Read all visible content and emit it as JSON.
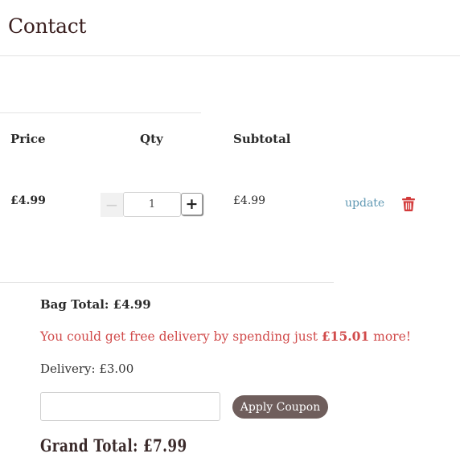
{
  "page": {
    "title": "Contact"
  },
  "cart": {
    "headers": {
      "price": "Price",
      "qty": "Qty",
      "subtotal": "Subtotal"
    },
    "item": {
      "price": "£4.99",
      "quantity": "1",
      "minus_label": "−",
      "plus_label": "+",
      "subtotal": "£4.99",
      "update_label": "update",
      "delete_icon": "trash-icon"
    }
  },
  "summary": {
    "bag_total": "Bag Total: £4.99",
    "free_delivery_prefix": "You could get free delivery by spending just ",
    "free_delivery_amount": "£15.01",
    "free_delivery_suffix": " more!",
    "delivery": "Delivery: £3.00",
    "coupon_placeholder": "",
    "apply_coupon_label": "Apply Coupon",
    "grand_total": "Grand Total: £7.99"
  },
  "colors": {
    "accent_link": "#5f98b3",
    "warning_text": "#d14b4b",
    "delete_icon": "#d33b3b",
    "coupon_button": "#6f5e5c"
  }
}
